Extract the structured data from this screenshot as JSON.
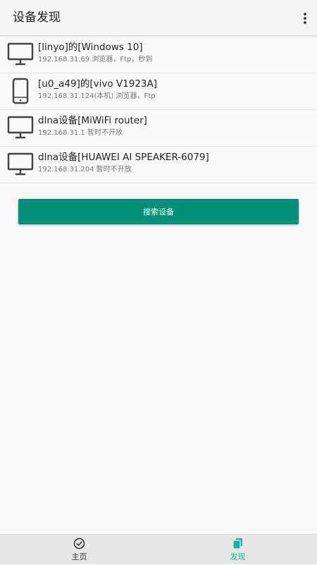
{
  "appbar": {
    "title": "设备发现",
    "more_icon": "more-vertical-icon"
  },
  "devices": [
    {
      "name": "[linyo]的[Windows 10]",
      "info": "192.168.31.69  浏览器，Ftp，秒到",
      "icon": "monitor-icon"
    },
    {
      "name": "[u0_a49]的[vivo V1923A]",
      "info": "192.168.31.124(本机)  浏览器，Ftp",
      "icon": "phone-icon"
    },
    {
      "name": "dlna设备[MiWiFi router]",
      "info": "192.168.31.1  暂时不开放",
      "icon": "monitor-icon"
    },
    {
      "name": "dlna设备[HUAWEI AI SPEAKER-6079]",
      "info": "192.168.31.204  暂时不开放",
      "icon": "monitor-icon"
    }
  ],
  "search_button": {
    "label": "搜索设备"
  },
  "bottom_nav": {
    "items": [
      {
        "label": "主页",
        "icon": "compass-icon",
        "active": false
      },
      {
        "label": "发现",
        "icon": "cards-icon",
        "active": true
      }
    ]
  },
  "colors": {
    "accent": "#009077",
    "active_nav": "#1ab3a0",
    "background": "#f9f9f9",
    "appbar": "#f5f5f5",
    "bottom_nav": "#e6e6e6"
  }
}
